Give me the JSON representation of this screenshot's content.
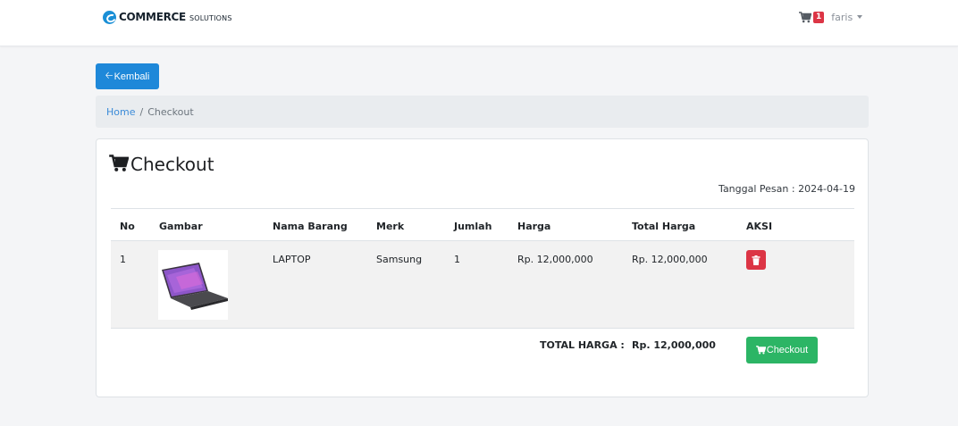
{
  "navbar": {
    "brand_strong": "COMMERCE",
    "brand_light": "SOLUTIONS",
    "cart_count": "1",
    "user_name": "faris"
  },
  "back_button": {
    "label": "Kembali"
  },
  "breadcrumb": {
    "home": "Home",
    "separator": "/",
    "current": "Checkout"
  },
  "checkout": {
    "title": "Checkout",
    "order_date": "Tanggal Pesan : 2024-04-19",
    "columns": [
      "No",
      "Gambar",
      "Nama Barang",
      "Merk",
      "Jumlah",
      "Harga",
      "Total Harga",
      "AKSI"
    ],
    "items": [
      {
        "no": "1",
        "name": "LAPTOP",
        "brand": "Samsung",
        "qty": "1",
        "price": "Rp. 12,000,000",
        "total": "Rp. 12,000,000"
      }
    ],
    "total_label": "TOTAL HARGA :",
    "total_value": "Rp. 12,000,000",
    "checkout_button": "Checkout"
  },
  "colors": {
    "primary": "#1e88d9",
    "danger": "#dc3545",
    "success": "#2cb565",
    "link": "#3b8bd8"
  }
}
